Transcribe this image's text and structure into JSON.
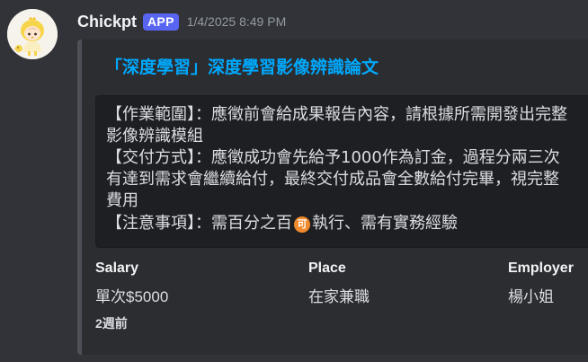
{
  "message": {
    "username": "Chickpt",
    "app_tag": "APP",
    "timestamp": "1/4/2025 8:49 PM",
    "avatar_icon": "chick-avatar-icon"
  },
  "embed": {
    "title": "「深度學習」深度學習影像辨識論文",
    "description_lines": [
      "【作業範圍】：應徵前會給成果報告內容，請根據所需開發出完整",
      "影像辨識模組",
      "【交付方式】：應徵成功會先給予1000作為訂金，過程分兩三次",
      "有達到需求會繼續給付，最終交付成品會全數給付完畢，視完整",
      "費用"
    ],
    "note_prefix": "【注意事項】：需百分之百",
    "note_emoji": "可",
    "note_suffix": "執行、需有實務經驗",
    "fields": [
      {
        "name": "Salary",
        "value": "單次$5000"
      },
      {
        "name": "Place",
        "value": "在家兼職"
      },
      {
        "name": "Employer",
        "value": "楊小姐"
      }
    ],
    "footer": "2週前"
  },
  "colors": {
    "background": "#313338",
    "embed_background": "#2b2d31",
    "codeblock_background": "#1e1f22",
    "title_link": "#00a8fc",
    "app_tag": "#5865f2",
    "emoji_badge": "#f18a2c"
  }
}
